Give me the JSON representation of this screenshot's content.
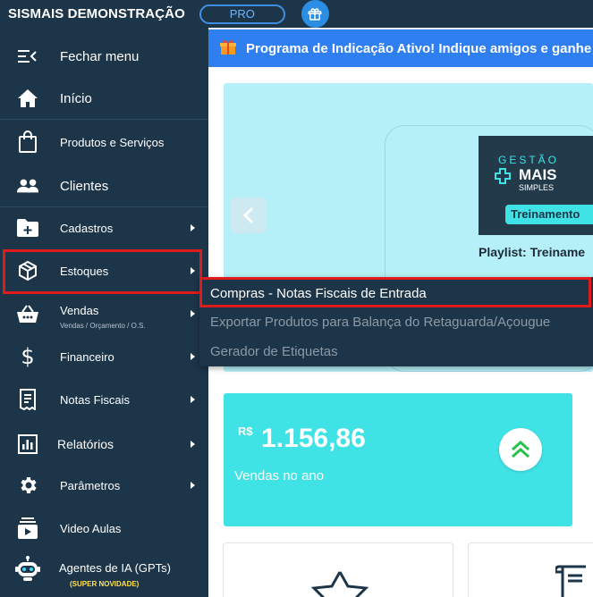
{
  "topbar": {
    "brand": "SISMAIS DEMONSTRAÇÃO",
    "plan_badge": "PRO",
    "gift_icon": "gift-icon"
  },
  "sidebar": {
    "items": [
      {
        "label": "Fechar menu",
        "icon": "menu-collapse-icon"
      },
      {
        "label": "Início",
        "icon": "home-icon"
      },
      {
        "label": "Produtos e Serviços",
        "icon": "shopping-bag-icon"
      },
      {
        "label": "Clientes",
        "icon": "people-icon"
      },
      {
        "label": "Cadastros",
        "icon": "folder-plus-icon"
      },
      {
        "label": "Estoques",
        "icon": "box-icon"
      },
      {
        "label": "Vendas",
        "sublabel": "Vendas / Orçamento / O.S.",
        "icon": "basket-icon"
      },
      {
        "label": "Financeiro",
        "icon": "dollar-icon"
      },
      {
        "label": "Notas Fiscais",
        "icon": "receipt-icon"
      },
      {
        "label": "Relatórios",
        "icon": "bar-chart-icon"
      },
      {
        "label": "Parâmetros",
        "icon": "gear-icon"
      },
      {
        "label": "Video Aulas",
        "icon": "video-library-icon"
      },
      {
        "label": "Agentes de IA (GPTs)",
        "badge": "(SUPER NOVIDADE)",
        "icon": "robot-icon"
      }
    ]
  },
  "submenu": {
    "options": [
      "Compras - Notas Fiscais de Entrada",
      "Exportar Produtos para Balança do Retaguarda/Açougue",
      "Gerador de Etiquetas"
    ]
  },
  "banner": {
    "text": "Programa de Indicação Ativo! Indique amigos e ganhe C"
  },
  "carousel": {
    "thumb_line1": "GESTÃO",
    "thumb_line2": "MAIS",
    "thumb_line3": "SIMPLES",
    "thumb_tag": "Treinamento",
    "title": "Playlist: Treiname"
  },
  "sales": {
    "currency": "R$",
    "amount": "1.156,86",
    "label": "Vendas no ano"
  },
  "colors": {
    "sidebar_bg": "#1d3549",
    "banner_bg": "#2f7ff0",
    "carousel_bg": "#b5f0f8",
    "sales_card_bg": "#3fe2e5",
    "highlight": "#e01b1b"
  }
}
